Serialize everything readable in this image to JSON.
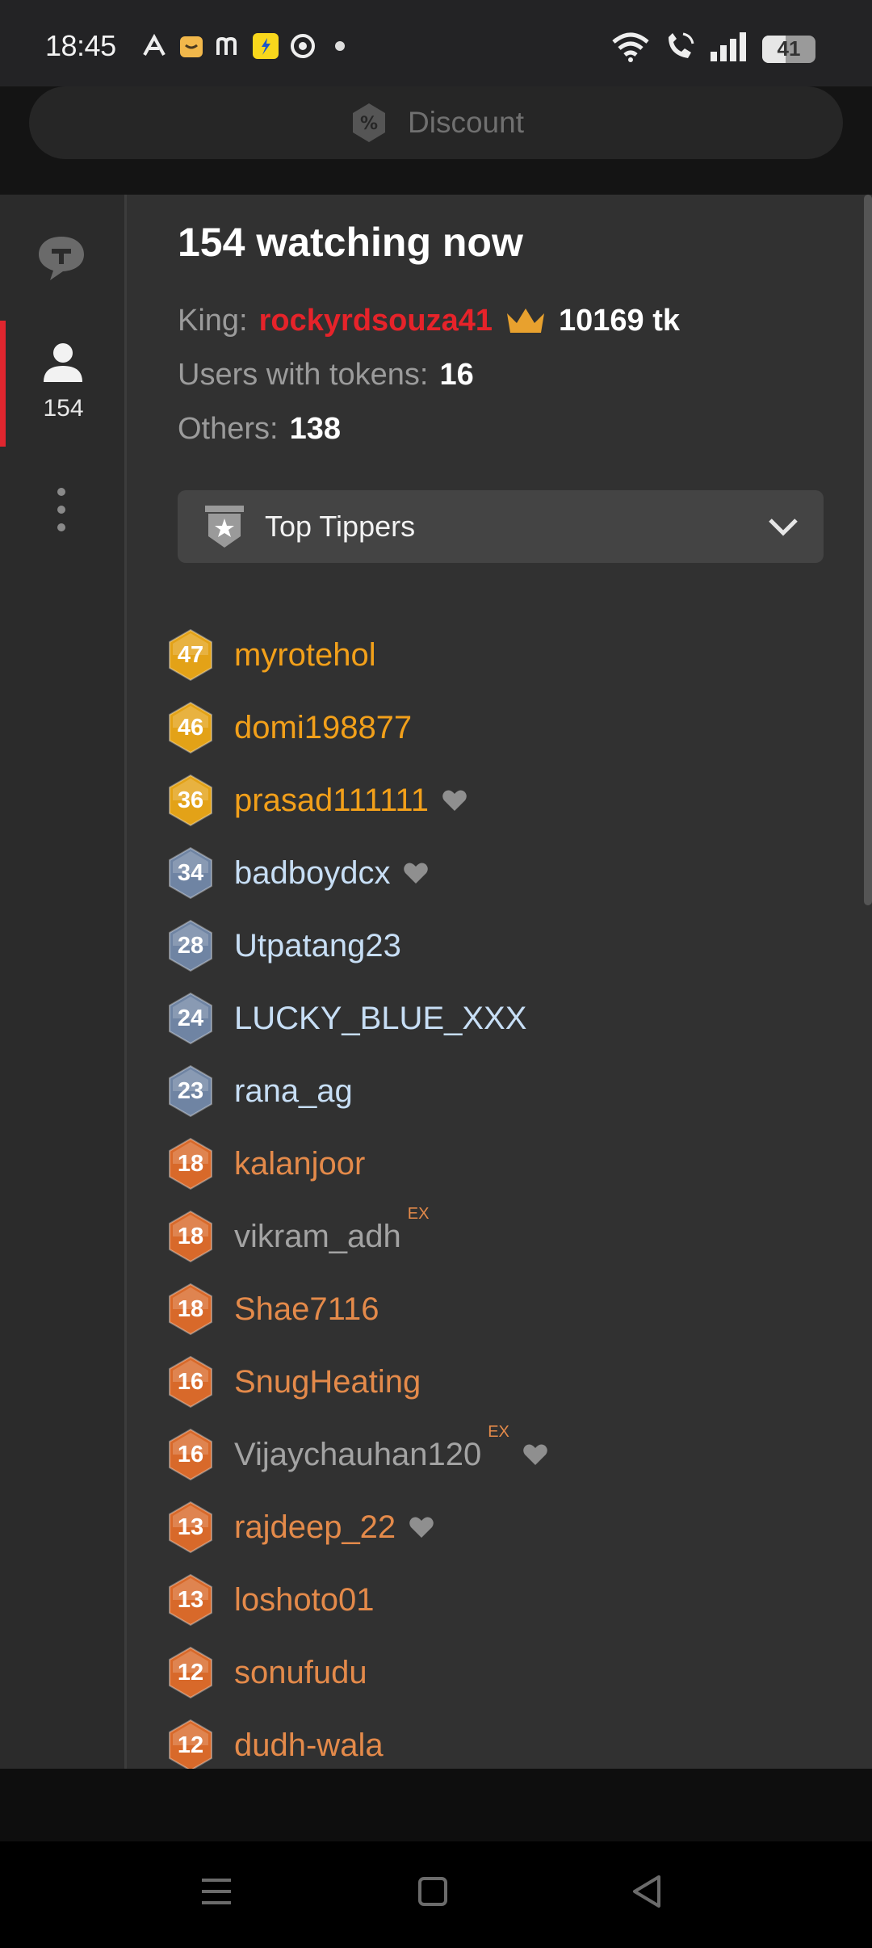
{
  "status_bar": {
    "time": "18:45",
    "battery": "41",
    "left_icons": [
      "a-icon",
      "shopping-bag-icon",
      "m-icon",
      "flipkart-icon",
      "chrome-icon",
      "dot-icon"
    ],
    "right_icons": [
      "wifi-icon",
      "wifi-call-icon",
      "signal-icon",
      "battery-icon"
    ]
  },
  "discount": {
    "label": "Discount",
    "icon": "percent-icon"
  },
  "rail": {
    "chat_icon": "chat-bubble-icon",
    "users_icon": "user-icon",
    "users_count": "154",
    "more_icon": "more-vertical-icon",
    "active_color": "#e0262f"
  },
  "summary": {
    "watching": "154 watching now",
    "king_label": "King:",
    "king_name": "rockyrdsouza41",
    "king_tokens": "10169 tk",
    "tokens_label": "Users with tokens:",
    "tokens_value": "16",
    "others_label": "Others:",
    "others_value": "138"
  },
  "filter": {
    "label": "Top Tippers",
    "icon": "top-tipper-badge-icon",
    "chevron": "chevron-down-icon"
  },
  "users": [
    {
      "level": "47",
      "name": "myrotehol",
      "tier": "gold",
      "ex": "",
      "heart": false
    },
    {
      "level": "46",
      "name": "domi198877",
      "tier": "gold",
      "ex": "",
      "heart": false
    },
    {
      "level": "36",
      "name": "prasad111111",
      "tier": "gold",
      "ex": "",
      "heart": true
    },
    {
      "level": "34",
      "name": "badboydcx",
      "tier": "blue",
      "ex": "",
      "heart": true
    },
    {
      "level": "28",
      "name": "Utpatang23",
      "tier": "blue",
      "ex": "",
      "heart": false
    },
    {
      "level": "24",
      "name": "LUCKY_BLUE_XXX",
      "tier": "blue",
      "ex": "",
      "heart": false
    },
    {
      "level": "23",
      "name": "rana_ag",
      "tier": "blue",
      "ex": "",
      "heart": false
    },
    {
      "level": "18",
      "name": "kalanjoor",
      "tier": "orange",
      "ex": "",
      "heart": false
    },
    {
      "level": "18",
      "name": "vikram_adh",
      "tier": "grey",
      "ex": "EX",
      "heart": false
    },
    {
      "level": "18",
      "name": "Shae7116",
      "tier": "orange",
      "ex": "",
      "heart": false
    },
    {
      "level": "16",
      "name": "SnugHeating",
      "tier": "orange",
      "ex": "",
      "heart": false
    },
    {
      "level": "16",
      "name": "Vijaychauhan120",
      "tier": "grey",
      "ex": "EX",
      "heart": true
    },
    {
      "level": "13",
      "name": "rajdeep_22",
      "tier": "orange",
      "ex": "",
      "heart": true
    },
    {
      "level": "13",
      "name": "loshoto01",
      "tier": "orange",
      "ex": "",
      "heart": false
    },
    {
      "level": "12",
      "name": "sonufudu",
      "tier": "orange",
      "ex": "",
      "heart": false
    },
    {
      "level": "12",
      "name": "dudh-wala",
      "tier": "orange",
      "ex": "",
      "heart": false
    }
  ],
  "colors": {
    "gold_badge": "#e3a217",
    "blue_badge": "#6f84a3",
    "orange_badge": "#d8692a",
    "king": "#e6232a"
  },
  "nav": {
    "icons": [
      "menu-icon",
      "home-square-icon",
      "back-triangle-icon"
    ]
  }
}
